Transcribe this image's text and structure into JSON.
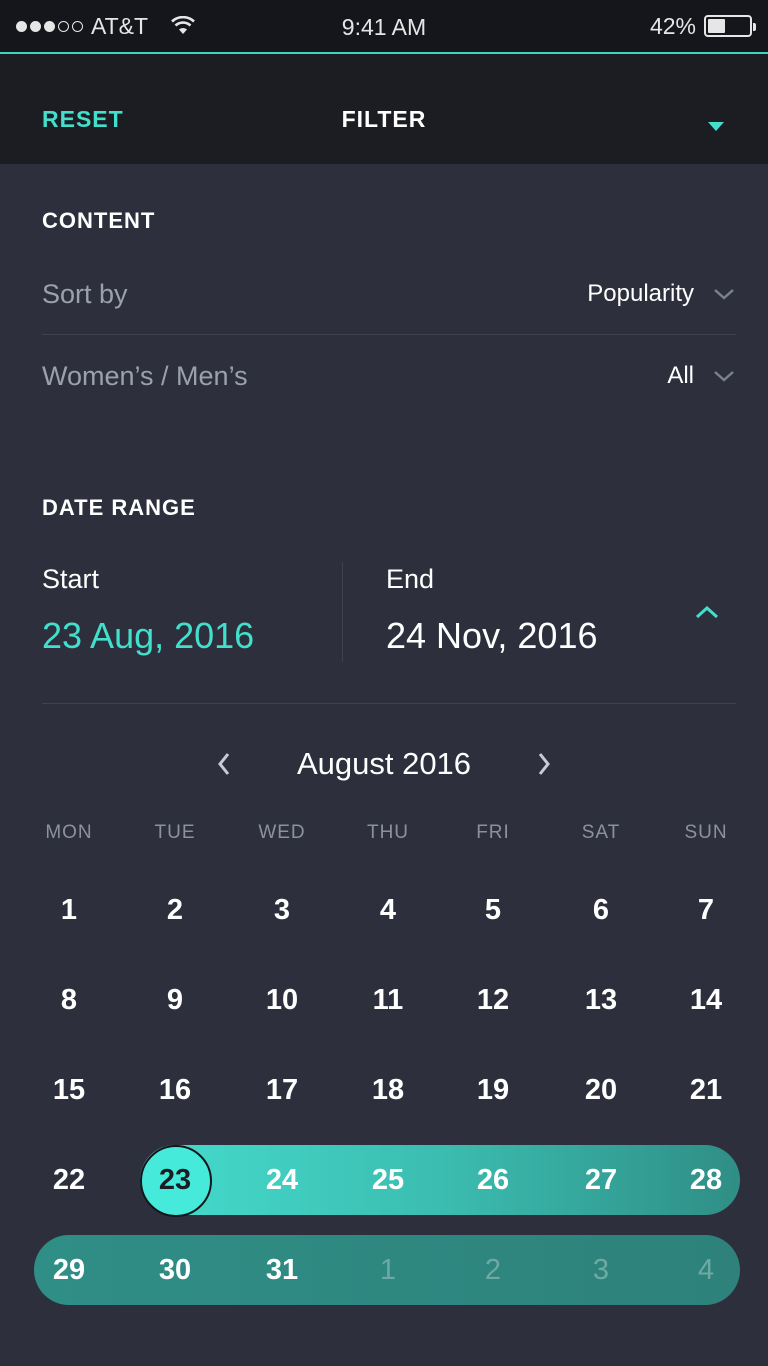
{
  "status_bar": {
    "carrier": "AT&T",
    "time": "9:41 AM",
    "battery": "42%",
    "battery_level": 0.42
  },
  "header": {
    "reset_label": "RESET",
    "title": "FILTER"
  },
  "content": {
    "heading": "CONTENT",
    "sort_label": "Sort by",
    "sort_value": "Popularity",
    "gender_label": "Women’s / Men’s",
    "gender_value": "All"
  },
  "date_range": {
    "heading": "DATE RANGE",
    "start_label": "Start",
    "start_value": "23 Aug, 2016",
    "end_label": "End",
    "end_value": "24 Nov, 2016"
  },
  "calendar": {
    "month": "August 2016",
    "weekdays": [
      "MON",
      "TUE",
      "WED",
      "THU",
      "FRI",
      "SAT",
      "SUN"
    ],
    "weeks": [
      [
        "1",
        "2",
        "3",
        "4",
        "5",
        "6",
        "7"
      ],
      [
        "8",
        "9",
        "10",
        "11",
        "12",
        "13",
        "14"
      ],
      [
        "15",
        "16",
        "17",
        "18",
        "19",
        "20",
        "21"
      ],
      [
        "22",
        "23",
        "24",
        "25",
        "26",
        "27",
        "28"
      ],
      [
        "29",
        "30",
        "31",
        "1",
        "2",
        "3",
        "4"
      ]
    ],
    "selected_day": "23"
  },
  "colors": {
    "accent": "#42e0cc",
    "background": "#2d303c",
    "header": "#1c1d23"
  }
}
